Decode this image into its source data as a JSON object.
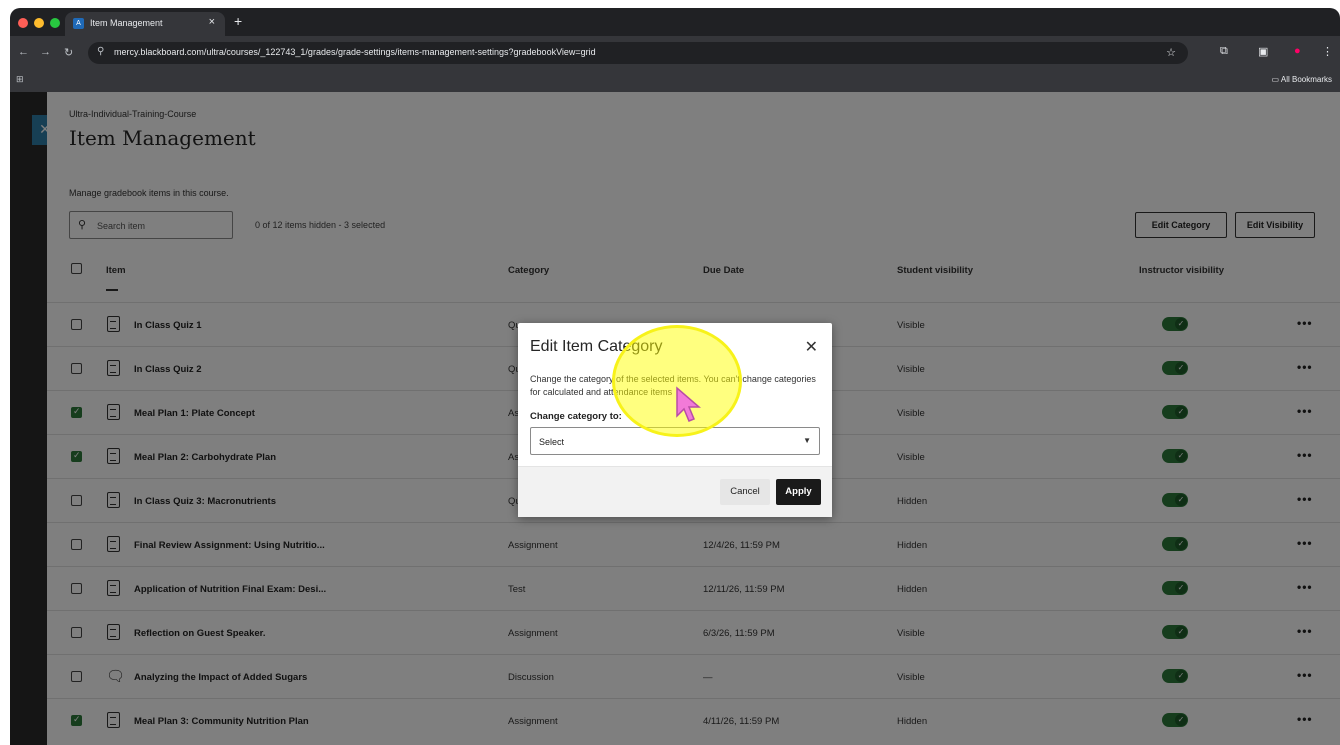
{
  "browser": {
    "tab_title": "Item Management",
    "tab_close": "×",
    "new_tab": "+",
    "url": "mercy.blackboard.com/ultra/courses/_122743_1/grades/grade-settings/items-management-settings?gradebookView=grid",
    "bookmarks_label": "All Bookmarks"
  },
  "page": {
    "breadcrumb": "Ultra-Individual-Training-Course",
    "title": "Item Management",
    "description": "Manage gradebook items in this course.",
    "search_placeholder": "Search item",
    "counts": "0 of 12 items hidden - 3 selected",
    "edit_category_label": "Edit Category",
    "edit_visibility_label": "Edit Visibility"
  },
  "table": {
    "headers": {
      "item": "Item",
      "category": "Category",
      "due_date": "Due Date",
      "student_visibility": "Student visibility",
      "instructor_visibility": "Instructor visibility"
    },
    "rows": [
      {
        "name": "In Class Quiz 1",
        "category": "Qu",
        "due": "",
        "visibility": "Visible",
        "selected": false,
        "icon": "quiz-icon"
      },
      {
        "name": "In Class Quiz 2",
        "category": "Qu",
        "due": "",
        "visibility": "Visible",
        "selected": false,
        "icon": "quiz-icon"
      },
      {
        "name": "Meal Plan 1: Plate Concept",
        "category": "As",
        "due": "",
        "visibility": "Visible",
        "selected": true,
        "icon": "assignment-icon"
      },
      {
        "name": "Meal Plan 2: Carbohydrate Plan",
        "category": "As",
        "due": "",
        "visibility": "Visible",
        "selected": true,
        "icon": "assignment-icon"
      },
      {
        "name": "In Class Quiz 3: Macronutrients",
        "category": "Qu",
        "due": "",
        "visibility": "Hidden",
        "selected": false,
        "icon": "quiz-icon"
      },
      {
        "name": "Final Review Assignment: Using Nutritio...",
        "category": "Assignment",
        "due": "12/4/26, 11:59 PM",
        "visibility": "Hidden",
        "selected": false,
        "icon": "assignment-icon"
      },
      {
        "name": "Application of Nutrition Final Exam: Desi...",
        "category": "Test",
        "due": "12/11/26, 11:59 PM",
        "visibility": "Hidden",
        "selected": false,
        "icon": "test-icon"
      },
      {
        "name": "Reflection on Guest Speaker.",
        "category": "Assignment",
        "due": "6/3/26, 11:59 PM",
        "visibility": "Visible",
        "selected": false,
        "icon": "assignment-icon"
      },
      {
        "name": "Analyzing the Impact of Added Sugars",
        "category": "Discussion",
        "due": "—",
        "visibility": "Visible",
        "selected": false,
        "icon": "discussion-icon"
      },
      {
        "name": "Meal Plan 3: Community Nutrition Plan",
        "category": "Assignment",
        "due": "4/11/26, 11:59 PM",
        "visibility": "Hidden",
        "selected": true,
        "icon": "assignment-icon"
      }
    ],
    "more_label": "•••"
  },
  "modal": {
    "title": "Edit Item Category",
    "close": "✕",
    "description": "Change the category of the selected items. You can't change categories for calculated and attendance items",
    "field_label": "Change category to:",
    "select_value": "Select",
    "cancel_label": "Cancel",
    "apply_label": "Apply"
  },
  "colors": {
    "accent_green": "#2d7a3a",
    "close_blue": "#2f7fa8",
    "highlight_yellow": "#f7f21a"
  }
}
